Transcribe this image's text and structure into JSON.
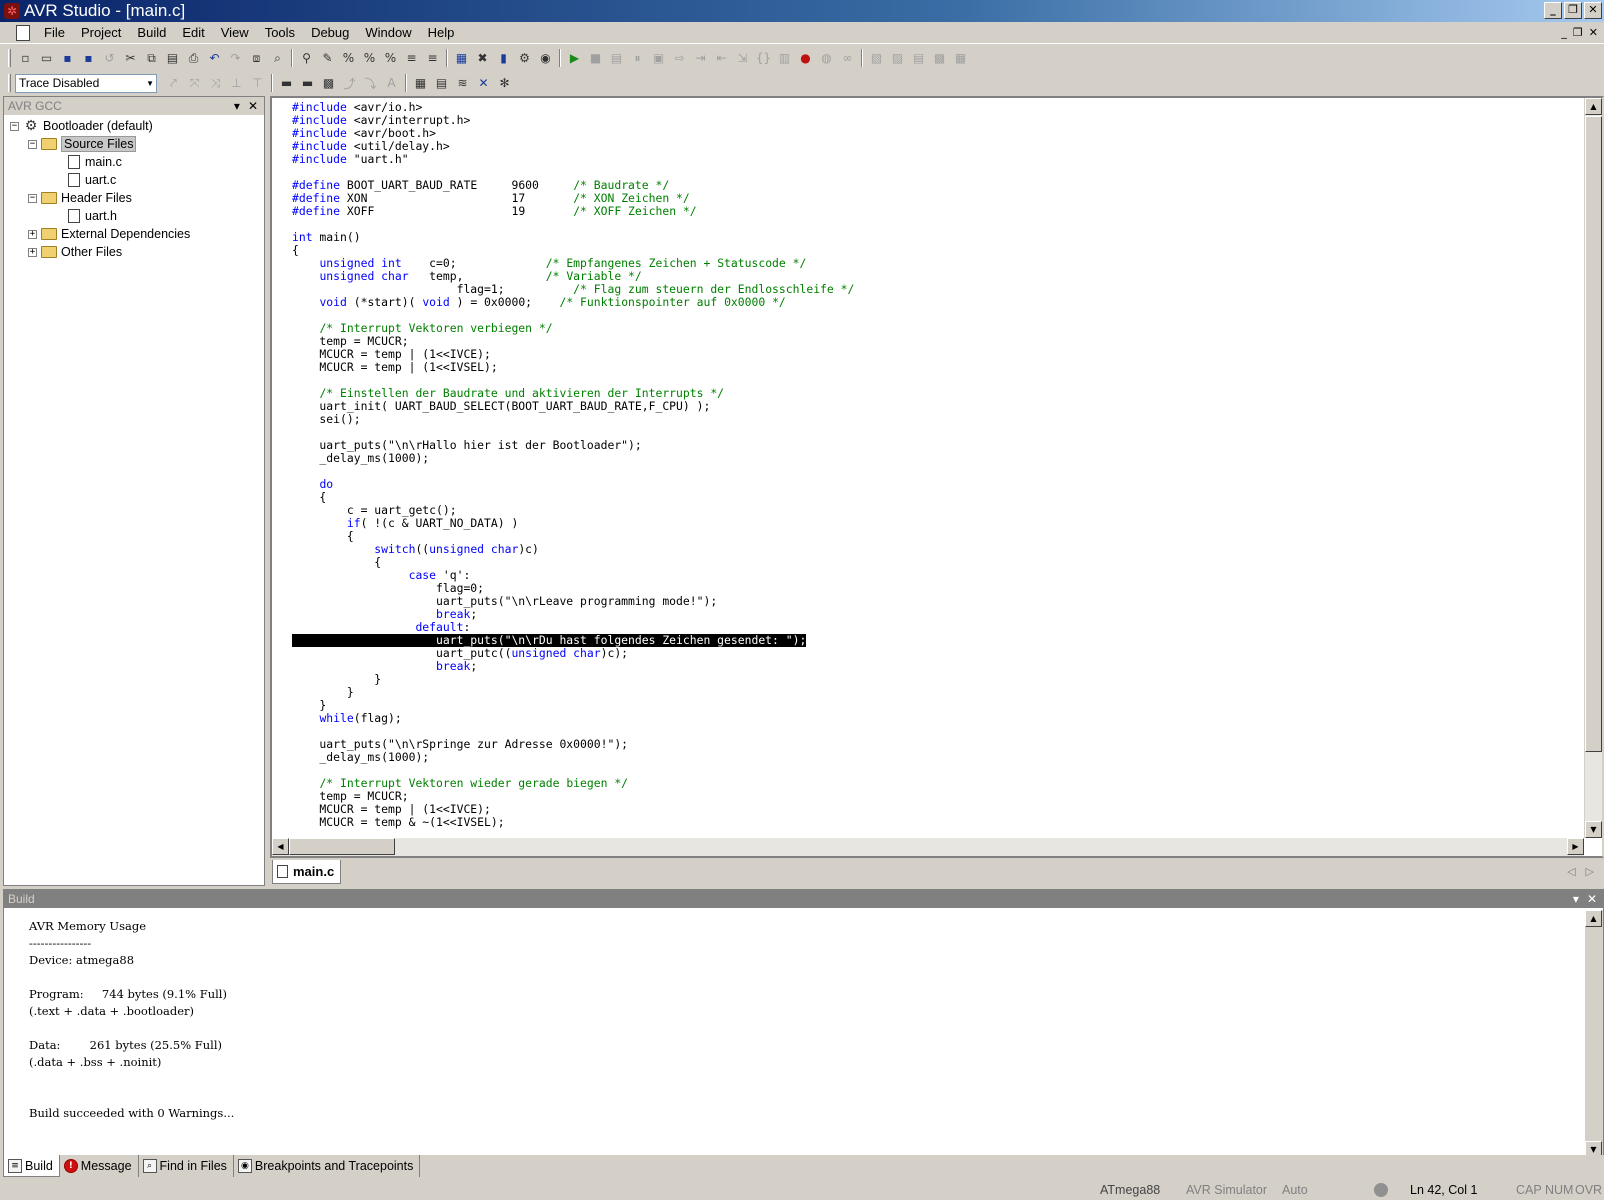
{
  "window": {
    "title": "AVR Studio - [main.c]",
    "controls": [
      "_",
      "❐",
      "✕"
    ]
  },
  "menu": [
    "File",
    "Project",
    "Build",
    "Edit",
    "View",
    "Tools",
    "Debug",
    "Window",
    "Help"
  ],
  "toolbar2": {
    "trace_select": "Trace Disabled"
  },
  "left_panel": {
    "title": "AVR GCC",
    "tree": {
      "project": "Bootloader (default)",
      "source_folder": "Source Files",
      "source_files": [
        "main.c",
        "uart.c"
      ],
      "header_folder": "Header Files",
      "header_files": [
        "uart.h"
      ],
      "external": "External Dependencies",
      "other": "Other Files"
    }
  },
  "editor": {
    "active_tab": "main.c",
    "code_lines": [
      [
        [
          "kw",
          "#include"
        ],
        [
          "t",
          " <avr/io.h>"
        ]
      ],
      [
        [
          "kw",
          "#include"
        ],
        [
          "t",
          " <avr/interrupt.h>"
        ]
      ],
      [
        [
          "kw",
          "#include"
        ],
        [
          "t",
          " <avr/boot.h>"
        ]
      ],
      [
        [
          "kw",
          "#include"
        ],
        [
          "t",
          " <util/delay.h>"
        ]
      ],
      [
        [
          "kw",
          "#include"
        ],
        [
          "t",
          " \"uart.h\""
        ]
      ],
      [],
      [
        [
          "kw",
          "#define"
        ],
        [
          "t",
          " BOOT_UART_BAUD_RATE     9600     "
        ],
        [
          "cm",
          "/* Baudrate */"
        ]
      ],
      [
        [
          "kw",
          "#define"
        ],
        [
          "t",
          " XON                     17       "
        ],
        [
          "cm",
          "/* XON Zeichen */"
        ]
      ],
      [
        [
          "kw",
          "#define"
        ],
        [
          "t",
          " XOFF                    19       "
        ],
        [
          "cm",
          "/* XOFF Zeichen */"
        ]
      ],
      [],
      [
        [
          "kw",
          "int"
        ],
        [
          "t",
          " main()"
        ]
      ],
      [
        [
          "t",
          "{"
        ]
      ],
      [
        [
          "t",
          "    "
        ],
        [
          "kw",
          "unsigned int"
        ],
        [
          "t",
          "    c=0;             "
        ],
        [
          "cm",
          "/* Empfangenes Zeichen + Statuscode */"
        ]
      ],
      [
        [
          "t",
          "    "
        ],
        [
          "kw",
          "unsigned char"
        ],
        [
          "t",
          "   temp,            "
        ],
        [
          "cm",
          "/* Variable */"
        ]
      ],
      [
        [
          "t",
          "                        flag=1;          "
        ],
        [
          "cm",
          "/* Flag zum steuern der Endlosschleife */"
        ]
      ],
      [
        [
          "t",
          "    "
        ],
        [
          "kw",
          "void"
        ],
        [
          "t",
          " (*start)( "
        ],
        [
          "kw",
          "void"
        ],
        [
          "t",
          " ) = 0x0000;    "
        ],
        [
          "cm",
          "/* Funktionspointer auf 0x0000 */"
        ]
      ],
      [],
      [
        [
          "t",
          "    "
        ],
        [
          "cm",
          "/* Interrupt Vektoren verbiegen */"
        ]
      ],
      [
        [
          "t",
          "    temp = MCUCR;"
        ]
      ],
      [
        [
          "t",
          "    MCUCR = temp | (1<<IVCE);"
        ]
      ],
      [
        [
          "t",
          "    MCUCR = temp | (1<<IVSEL);"
        ]
      ],
      [],
      [
        [
          "t",
          "    "
        ],
        [
          "cm",
          "/* Einstellen der Baudrate und aktivieren der Interrupts */"
        ]
      ],
      [
        [
          "t",
          "    uart_init( UART_BAUD_SELECT(BOOT_UART_BAUD_RATE,F_CPU) );"
        ]
      ],
      [
        [
          "t",
          "    sei();"
        ]
      ],
      [],
      [
        [
          "t",
          "    uart_puts(\"\\n\\rHallo hier ist der Bootloader\");"
        ]
      ],
      [
        [
          "t",
          "    _delay_ms(1000);"
        ]
      ],
      [],
      [
        [
          "t",
          "    "
        ],
        [
          "kw",
          "do"
        ]
      ],
      [
        [
          "t",
          "    {"
        ]
      ],
      [
        [
          "t",
          "        c = uart_getc();"
        ]
      ],
      [
        [
          "t",
          "        "
        ],
        [
          "kw",
          "if"
        ],
        [
          "t",
          "( !(c & UART_NO_DATA) )"
        ]
      ],
      [
        [
          "t",
          "        {"
        ]
      ],
      [
        [
          "t",
          "            "
        ],
        [
          "kw",
          "switch"
        ],
        [
          "t",
          "(("
        ],
        [
          "kw",
          "unsigned char"
        ],
        [
          "t",
          ")c)"
        ]
      ],
      [
        [
          "t",
          "            {"
        ]
      ],
      [
        [
          "t",
          "                 "
        ],
        [
          "kw",
          "case"
        ],
        [
          "t",
          " 'q':"
        ]
      ],
      [
        [
          "t",
          "                     flag=0;"
        ]
      ],
      [
        [
          "t",
          "                     uart_puts(\"\\n\\rLeave programming mode!\");"
        ]
      ],
      [
        [
          "t",
          "                     "
        ],
        [
          "kw",
          "break"
        ],
        [
          "t",
          ";"
        ]
      ],
      [
        [
          "t",
          "                  "
        ],
        [
          "kw",
          "default"
        ],
        [
          "t",
          ":"
        ]
      ],
      [
        [
          "hl",
          "                     uart_puts(\"\\n\\rDu hast folgendes Zeichen gesendet: \");"
        ]
      ],
      [
        [
          "t",
          "                     uart_putc(("
        ],
        [
          "kw",
          "unsigned char"
        ],
        [
          "t",
          ")c);"
        ]
      ],
      [
        [
          "t",
          "                     "
        ],
        [
          "kw",
          "break"
        ],
        [
          "t",
          ";"
        ]
      ],
      [
        [
          "t",
          "            }"
        ]
      ],
      [
        [
          "t",
          "        }"
        ]
      ],
      [
        [
          "t",
          "    }"
        ]
      ],
      [
        [
          "t",
          "    "
        ],
        [
          "kw",
          "while"
        ],
        [
          "t",
          "(flag);"
        ]
      ],
      [],
      [
        [
          "t",
          "    uart_puts(\"\\n\\rSpringe zur Adresse 0x0000!\");"
        ]
      ],
      [
        [
          "t",
          "    _delay_ms(1000);"
        ]
      ],
      [],
      [
        [
          "t",
          "    "
        ],
        [
          "cm",
          "/* Interrupt Vektoren wieder gerade biegen */"
        ]
      ],
      [
        [
          "t",
          "    temp = MCUCR;"
        ]
      ],
      [
        [
          "t",
          "    MCUCR = temp | (1<<IVCE);"
        ]
      ],
      [
        [
          "t",
          "    MCUCR = temp & ~(1<<IVSEL);"
        ]
      ]
    ]
  },
  "build_panel": {
    "title": "Build",
    "lines": [
      "AVR Memory Usage",
      "----------------",
      "Device: atmega88",
      "",
      "Program:     744 bytes (9.1% Full)",
      "(.text + .data + .bootloader)",
      "",
      "Data:        261 bytes (25.5% Full)",
      "(.data + .bss + .noinit)",
      "",
      "",
      "Build succeeded with 0 Warnings..."
    ]
  },
  "bottom_tabs": [
    "Build",
    "Message",
    "Find in Files",
    "Breakpoints and Tracepoints"
  ],
  "status": {
    "device": "ATmega88",
    "platform": "AVR Simulator",
    "mode": "Auto",
    "position": "Ln 42, Col 1",
    "cap": "CAP",
    "num": "NUM",
    "ovr": "OVR"
  }
}
